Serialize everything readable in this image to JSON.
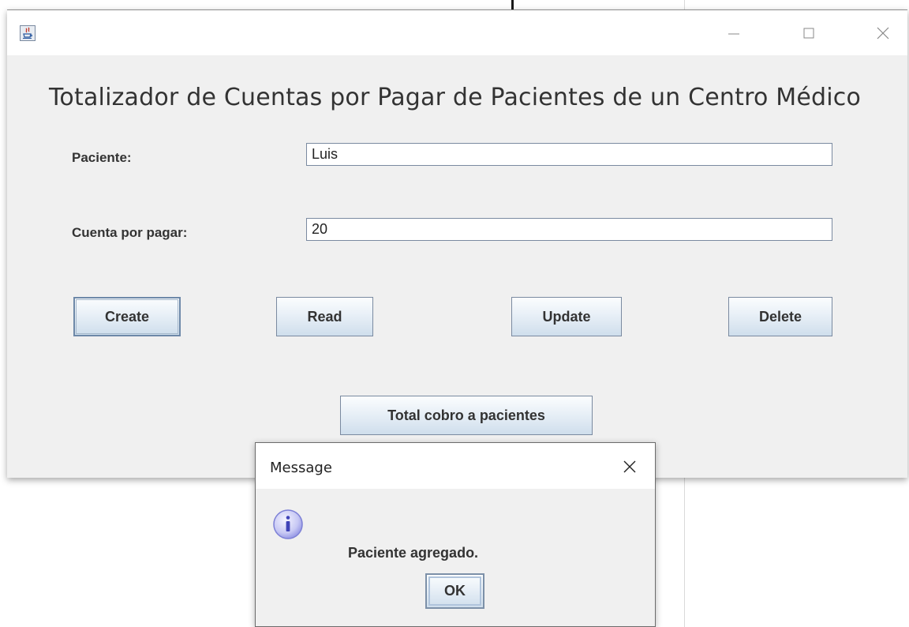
{
  "window": {
    "title": "Totalizador de Cuentas por Pagar de Pacientes de un Centro Médico",
    "controls": {
      "minimize_icon": "minimize-icon",
      "maximize_icon": "maximize-icon",
      "close_icon": "close-icon"
    }
  },
  "form": {
    "paciente_label": "Paciente:",
    "paciente_value": "Luis",
    "cuenta_label": "Cuenta por pagar:",
    "cuenta_value": "20"
  },
  "buttons": {
    "create": "Create",
    "read": "Read",
    "update": "Update",
    "delete": "Delete",
    "total": "Total cobro a pacientes"
  },
  "dialog": {
    "title": "Message",
    "message": "Paciente agregado.",
    "ok": "OK",
    "icon": "info-icon"
  },
  "colors": {
    "window_bg": "#f0f0f0",
    "button_border": "#7a8aa0",
    "info_icon": "#9a9ce6"
  }
}
